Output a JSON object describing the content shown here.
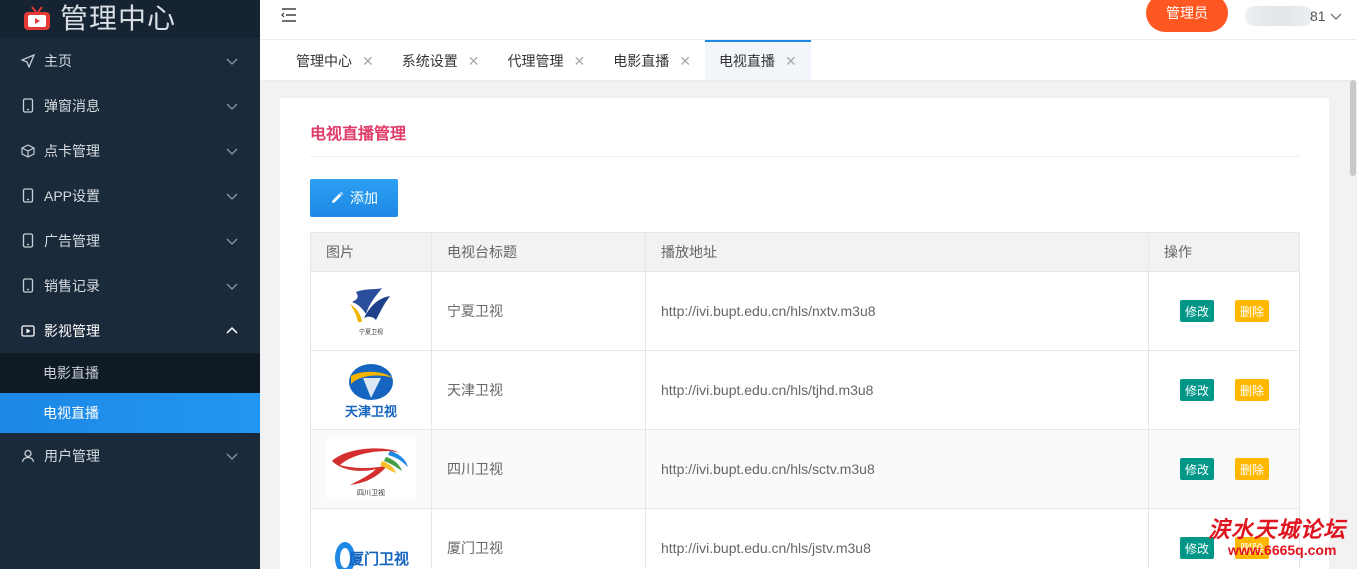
{
  "brand": {
    "title": "管理中心"
  },
  "sidebar": {
    "items": [
      {
        "label": "主页",
        "icon": "send-icon"
      },
      {
        "label": "弹窗消息",
        "icon": "phone-icon"
      },
      {
        "label": "点卡管理",
        "icon": "cube-icon"
      },
      {
        "label": "APP设置",
        "icon": "phone-icon"
      },
      {
        "label": "广告管理",
        "icon": "phone-icon"
      },
      {
        "label": "销售记录",
        "icon": "phone-icon"
      },
      {
        "label": "影视管理",
        "icon": "video-icon",
        "open": true
      },
      {
        "label": "用户管理",
        "icon": "user-icon"
      }
    ],
    "submenu": [
      {
        "label": "电影直播",
        "active": false
      },
      {
        "label": "电视直播",
        "active": true
      }
    ]
  },
  "header": {
    "admin_label": "管理员",
    "user_suffix": "81"
  },
  "tabs": [
    {
      "label": "管理中心",
      "active": false
    },
    {
      "label": "系统设置",
      "active": false
    },
    {
      "label": "代理管理",
      "active": false
    },
    {
      "label": "电影直播",
      "active": false
    },
    {
      "label": "电视直播",
      "active": true
    }
  ],
  "panel": {
    "title": "电视直播管理",
    "add_label": "添加",
    "columns": [
      "图片",
      "电视台标题",
      "播放地址",
      "操作"
    ],
    "rows": [
      {
        "logo": "宁夏卫视",
        "title": "宁夏卫视",
        "url": "http://ivi.bupt.edu.cn/hls/nxtv.m3u8"
      },
      {
        "logo": "天津卫视",
        "title": "天津卫视",
        "url": "http://ivi.bupt.edu.cn/hls/tjhd.m3u8"
      },
      {
        "logo": "四川卫视",
        "title": "四川卫视",
        "url": "http://ivi.bupt.edu.cn/hls/sctv.m3u8"
      },
      {
        "logo": "厦门卫视",
        "title": "厦门卫视",
        "url": "http://ivi.bupt.edu.cn/hls/jstv.m3u8"
      }
    ],
    "edit_label": "修改",
    "delete_label": "删除"
  },
  "colors": {
    "sidebar_bg": "#1b2a3a",
    "accent_blue": "#1e88e5",
    "admin_orange": "#ff5722",
    "edit_green": "#009688",
    "delete_yellow": "#ffb800",
    "title_pink": "#e03c6a"
  },
  "watermark": {
    "text_cn": "涙水天城论坛",
    "url": "www.6665q.com"
  }
}
